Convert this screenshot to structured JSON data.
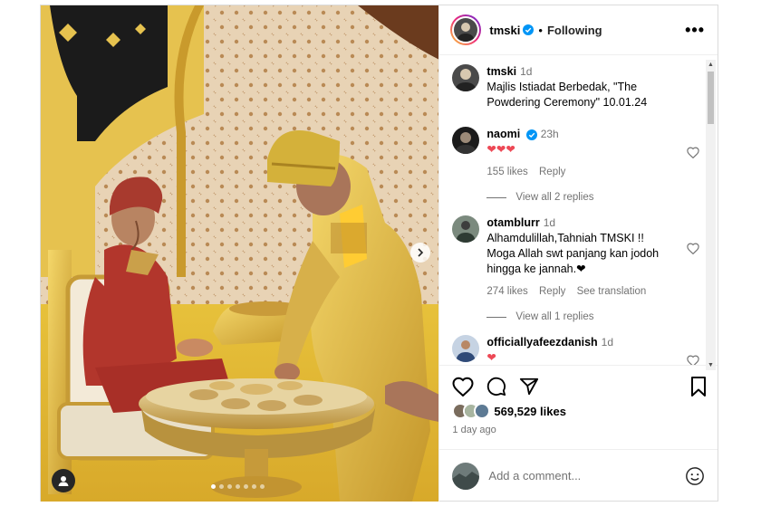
{
  "post": {
    "username": "tmski",
    "separator": "•",
    "follow_status": "Following",
    "more_label": "•••"
  },
  "carousel": {
    "dots": 7,
    "active_index": 0
  },
  "comments": [
    {
      "username": "tmski",
      "verified": false,
      "time": "1d",
      "text": "Majlis Istiadat Berbedak, \"The Powdering Ceremony\" 10.01.24",
      "caption": true
    },
    {
      "username": "naomi",
      "verified": true,
      "time": "23h",
      "text": "❤❤❤",
      "likes": "155 likes",
      "reply": "Reply",
      "view_replies": "View all 2 replies"
    },
    {
      "username": "otamblurr",
      "verified": false,
      "time": "1d",
      "text": "Alhamdulillah,Tahniah TMSKI !! Moga Allah swt panjang kan jodoh hingga ke jannah.❤",
      "likes": "274 likes",
      "reply": "Reply",
      "see_translation": "See translation",
      "view_replies": "View all 1 replies"
    },
    {
      "username": "officiallyafeezdanish",
      "verified": false,
      "time": "1d",
      "text": "❤"
    }
  ],
  "engagement": {
    "likes": "569,529 likes",
    "time_ago": "1 day ago"
  },
  "add_comment": {
    "placeholder": "Add a comment..."
  },
  "colors": {
    "verified_blue": "#0095f6",
    "heart_red": "#ed4956",
    "muted_text": "#737373"
  },
  "icons": [
    "verified-badge-icon",
    "heart-icon",
    "comment-icon",
    "share-icon",
    "bookmark-icon",
    "emoji-icon",
    "chevron-right-icon",
    "user-tag-icon"
  ]
}
